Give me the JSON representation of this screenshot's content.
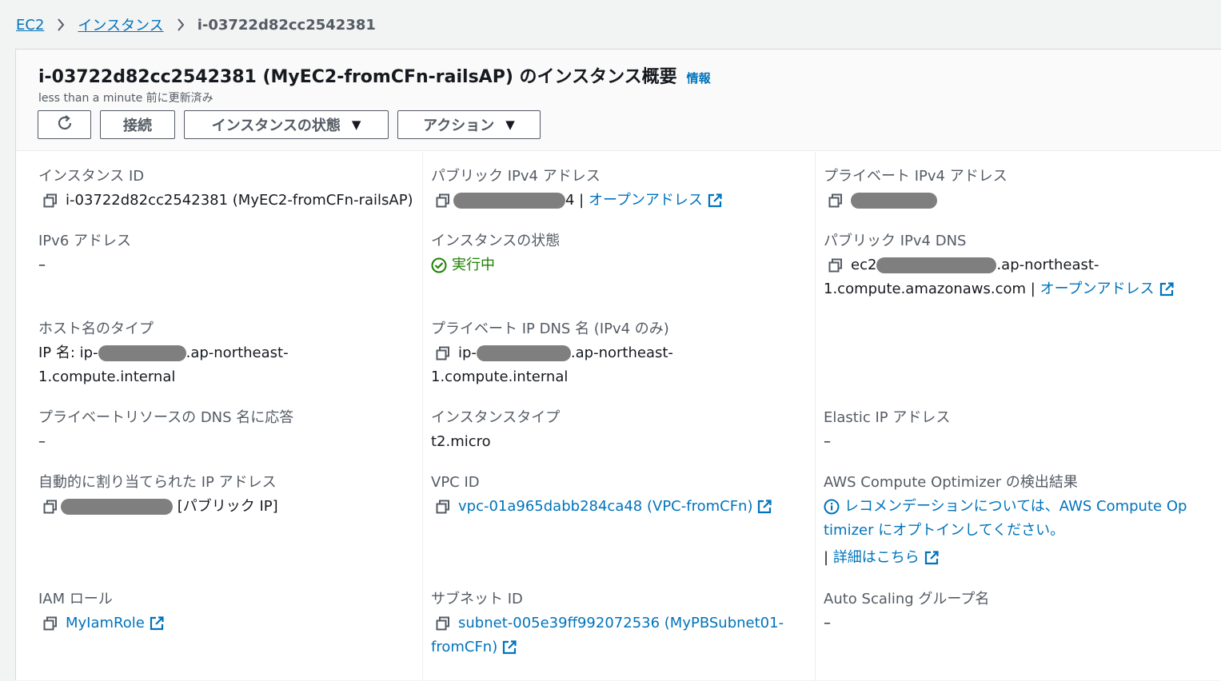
{
  "breadcrumb": {
    "root": "EC2",
    "instances": "インスタンス",
    "current": "i-03722d82cc2542381"
  },
  "header": {
    "title": "i-03722d82cc2542381 (MyEC2-fromCFn-railsAP) のインスタンス概要",
    "info": "情報",
    "subtitle": "less than a minute 前に更新済み",
    "buttons": {
      "refresh_icon": "refresh-icon",
      "connect": "接続",
      "instance_state": "インスタンスの状態",
      "actions": "アクション"
    }
  },
  "details": {
    "instance_id": {
      "label": "インスタンス ID",
      "value": "i-03722d82cc2542381 (MyEC2-fromCFn-railsAP)"
    },
    "public_ipv4": {
      "label": "パブリック IPv4 アドレス",
      "suffix": "4 |",
      "link": "オープンアドレス"
    },
    "private_ipv4": {
      "label": "プライベート IPv4 アドレス"
    },
    "ipv6": {
      "label": "IPv6 アドレス",
      "value": "–"
    },
    "instance_state": {
      "label": "インスタンスの状態",
      "value": "実行中"
    },
    "public_dns": {
      "label": "パブリック IPv4 DNS",
      "prefix": "ec2",
      "suffix": ".ap-northeast-",
      "line2": "1.compute.amazonaws.com |",
      "link": "オープンアドレス"
    },
    "hostname_type": {
      "label": "ホスト名のタイプ",
      "prefix": "IP 名: ip-",
      "suffix": ".ap-northeast-",
      "line2": "1.compute.internal"
    },
    "private_dns": {
      "label": "プライベート IP DNS 名 (IPv4 のみ)",
      "prefix": "ip-",
      "suffix": ".ap-northeast-1.compute.internal"
    },
    "resource_dns": {
      "label": "プライベートリソースの DNS 名に応答",
      "value": "–"
    },
    "instance_type": {
      "label": "インスタンスタイプ",
      "value": "t2.micro"
    },
    "elastic_ip": {
      "label": "Elastic IP アドレス",
      "value": "–"
    },
    "auto_ip": {
      "label": "自動的に割り当てられた IP アドレス",
      "suffix": "[パブリック IP]"
    },
    "vpc_id": {
      "label": "VPC ID",
      "value": "vpc-01a965dabb284ca48 (VPC-fromCFn)"
    },
    "optimizer": {
      "label": "AWS Compute Optimizer の検出結果",
      "line1": "レコメンデーションについては、AWS Compute Op",
      "line2": "timizer にオプトインしてください。",
      "sep": "|",
      "link": "詳細はこちら"
    },
    "iam_role": {
      "label": "IAM ロール",
      "value": "MyIamRole"
    },
    "subnet_id": {
      "label": "サブネット ID",
      "line1": "subnet-005e39ff992072536 (MyPBSubnet01-",
      "line2": "fromCFn)"
    },
    "asg": {
      "label": "Auto Scaling グループ名",
      "value": "–"
    }
  },
  "colors": {
    "link": "#0073bb",
    "running": "#1d8102",
    "redacted": "#7f7f7f"
  }
}
